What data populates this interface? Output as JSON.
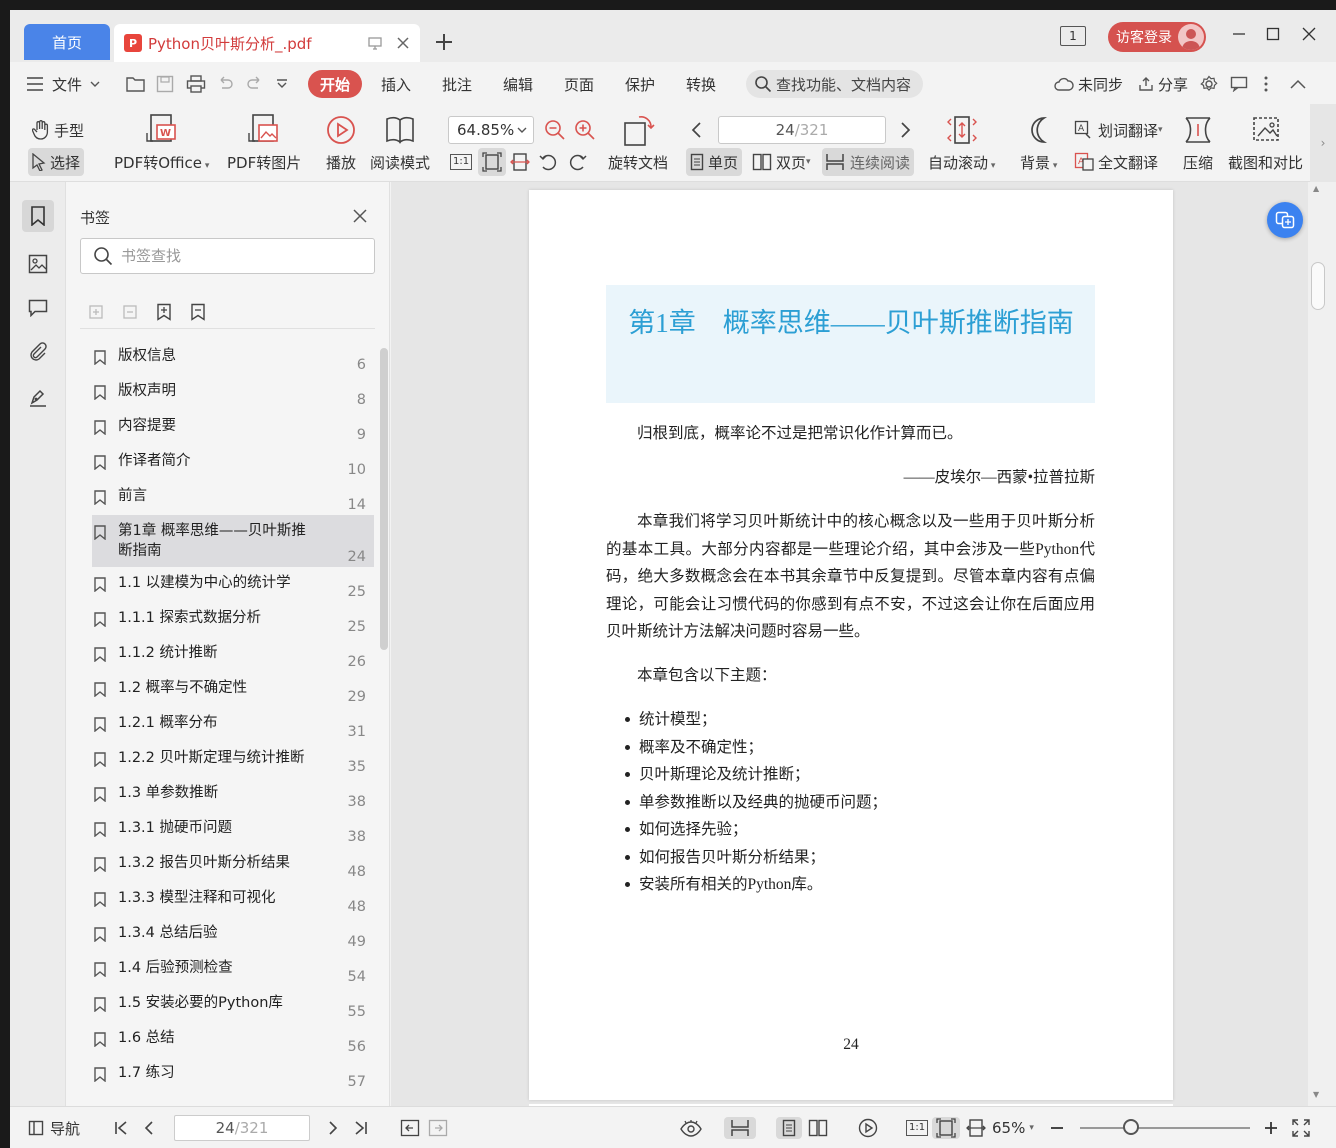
{
  "titlebar": {
    "home_tab": "首页",
    "doc_tab_title": "Python贝叶斯分析_.pdf",
    "login_label": "访客登录",
    "layout_indicator": "1"
  },
  "menubar": {
    "file": "文件",
    "tabs": [
      "开始",
      "插入",
      "批注",
      "编辑",
      "页面",
      "保护",
      "转换"
    ],
    "search_placeholder": "查找功能、文档内容",
    "sync": "未同步",
    "share": "分享"
  },
  "ribbon": {
    "hand": "手型",
    "select": "选择",
    "pdf_to_office": "PDF转Office",
    "pdf_to_image": "PDF转图片",
    "play": "播放",
    "read_mode": "阅读模式",
    "zoom": "64.85%",
    "rotate_doc": "旋转文档",
    "page_current": "24",
    "page_total": "/321",
    "single_page": "单页",
    "double_page": "双页",
    "continuous": "连续阅读",
    "auto_scroll": "自动滚动",
    "background": "背景",
    "word_translate": "划词翻译",
    "full_translate": "全文翻译",
    "compress": "压缩",
    "screenshot_compare": "截图和对比",
    "actual_size": "1:1"
  },
  "bookmarks": {
    "title": "书签",
    "search_placeholder": "书签查找",
    "items": [
      {
        "label": "版权信息",
        "page": "6"
      },
      {
        "label": "版权声明",
        "page": "8"
      },
      {
        "label": "内容提要",
        "page": "9"
      },
      {
        "label": "作译者简介",
        "page": "10"
      },
      {
        "label": "前言",
        "page": "14"
      },
      {
        "label": "第1章 概率思维——贝叶斯推断指南",
        "page": "24",
        "selected": true
      },
      {
        "label": "1.1 以建模为中心的统计学",
        "page": "25"
      },
      {
        "label": "1.1.1 探索式数据分析",
        "page": "25"
      },
      {
        "label": "1.1.2 统计推断",
        "page": "26"
      },
      {
        "label": "1.2 概率与不确定性",
        "page": "29"
      },
      {
        "label": "1.2.1 概率分布",
        "page": "31"
      },
      {
        "label": "1.2.2 贝叶斯定理与统计推断",
        "page": "35"
      },
      {
        "label": "1.3 单参数推断",
        "page": "38"
      },
      {
        "label": "1.3.1 抛硬币问题",
        "page": "38"
      },
      {
        "label": "1.3.2 报告贝叶斯分析结果",
        "page": "48"
      },
      {
        "label": "1.3.3 模型注释和可视化",
        "page": "48"
      },
      {
        "label": "1.3.4 总结后验",
        "page": "49"
      },
      {
        "label": "1.4 后验预测检查",
        "page": "54"
      },
      {
        "label": "1.5 安装必要的Python库",
        "page": "55"
      },
      {
        "label": "1.6 总结",
        "page": "56"
      },
      {
        "label": "1.7 练习",
        "page": "57"
      }
    ]
  },
  "document": {
    "chapter_title": "第1章　概率思维——贝叶斯推断指南",
    "quote": "归根到底，概率论不过是把常识化作计算而已。",
    "quote_author": "——皮埃尔—西蒙•拉普拉斯",
    "intro": "本章我们将学习贝叶斯统计中的核心概念以及一些用于贝叶斯分析的基本工具。大部分内容都是一些理论介绍，其中会涉及一些Python代码，绝大多数概念会在本书其余章节中反复提到。尽管本章内容有点偏理论，可能会让习惯代码的你感到有点不安，不过这会让你在后面应用贝叶斯统计方法解决问题时容易一些。",
    "topics_intro": "本章包含以下主题：",
    "topics": [
      "统计模型；",
      "概率及不确定性；",
      "贝叶斯理论及统计推断；",
      "单参数推断以及经典的抛硬币问题；",
      "如何选择先验；",
      "如何报告贝叶斯分析结果；",
      "安装所有相关的Python库。"
    ],
    "page_number": "24"
  },
  "statusbar": {
    "nav": "导航",
    "page_current": "24",
    "page_total": "/321",
    "zoom": "65%",
    "actual_size": "1:1",
    "zoom_level": 0.3
  }
}
